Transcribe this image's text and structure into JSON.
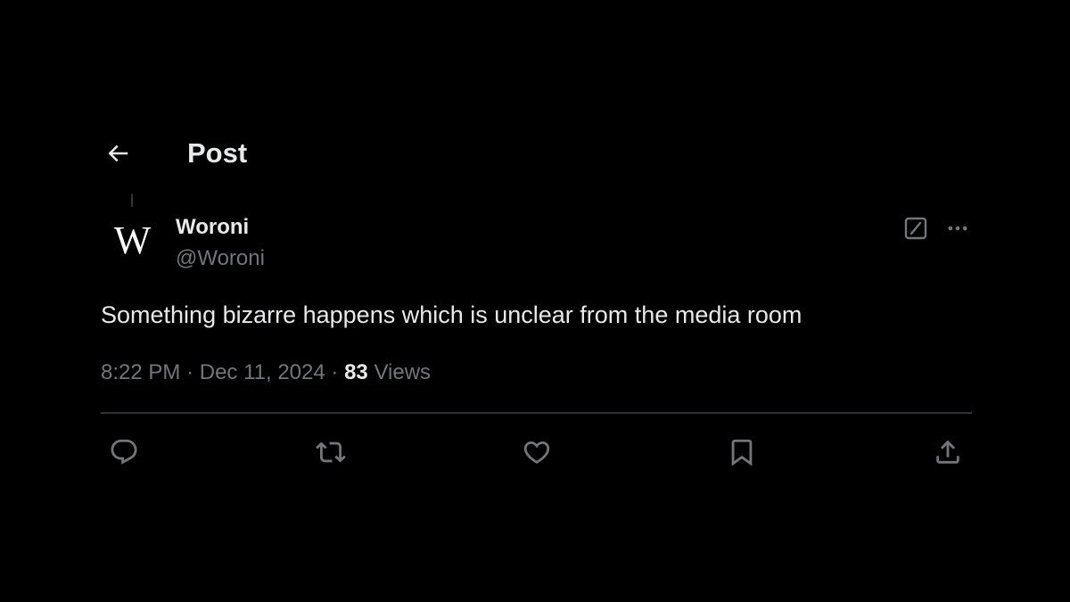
{
  "header": {
    "back_icon": "arrow-left-icon",
    "title": "Post"
  },
  "post": {
    "avatar_letter": "W",
    "display_name": "Woroni",
    "handle": "@Woroni",
    "text": "Something bizarre happens which is unclear from the media room",
    "time": "8:22 PM",
    "separator": "·",
    "date": "Dec 11, 2024",
    "views_count": "83",
    "views_label": "Views",
    "header_actions": [
      "grok-icon",
      "more-icon"
    ]
  },
  "actions": [
    "reply-icon",
    "retweet-icon",
    "like-icon",
    "bookmark-icon",
    "share-icon"
  ],
  "colors": {
    "background": "#000000",
    "primary_text": "#e7e9ea",
    "secondary_text": "#71767b",
    "divider": "#2f3336"
  }
}
